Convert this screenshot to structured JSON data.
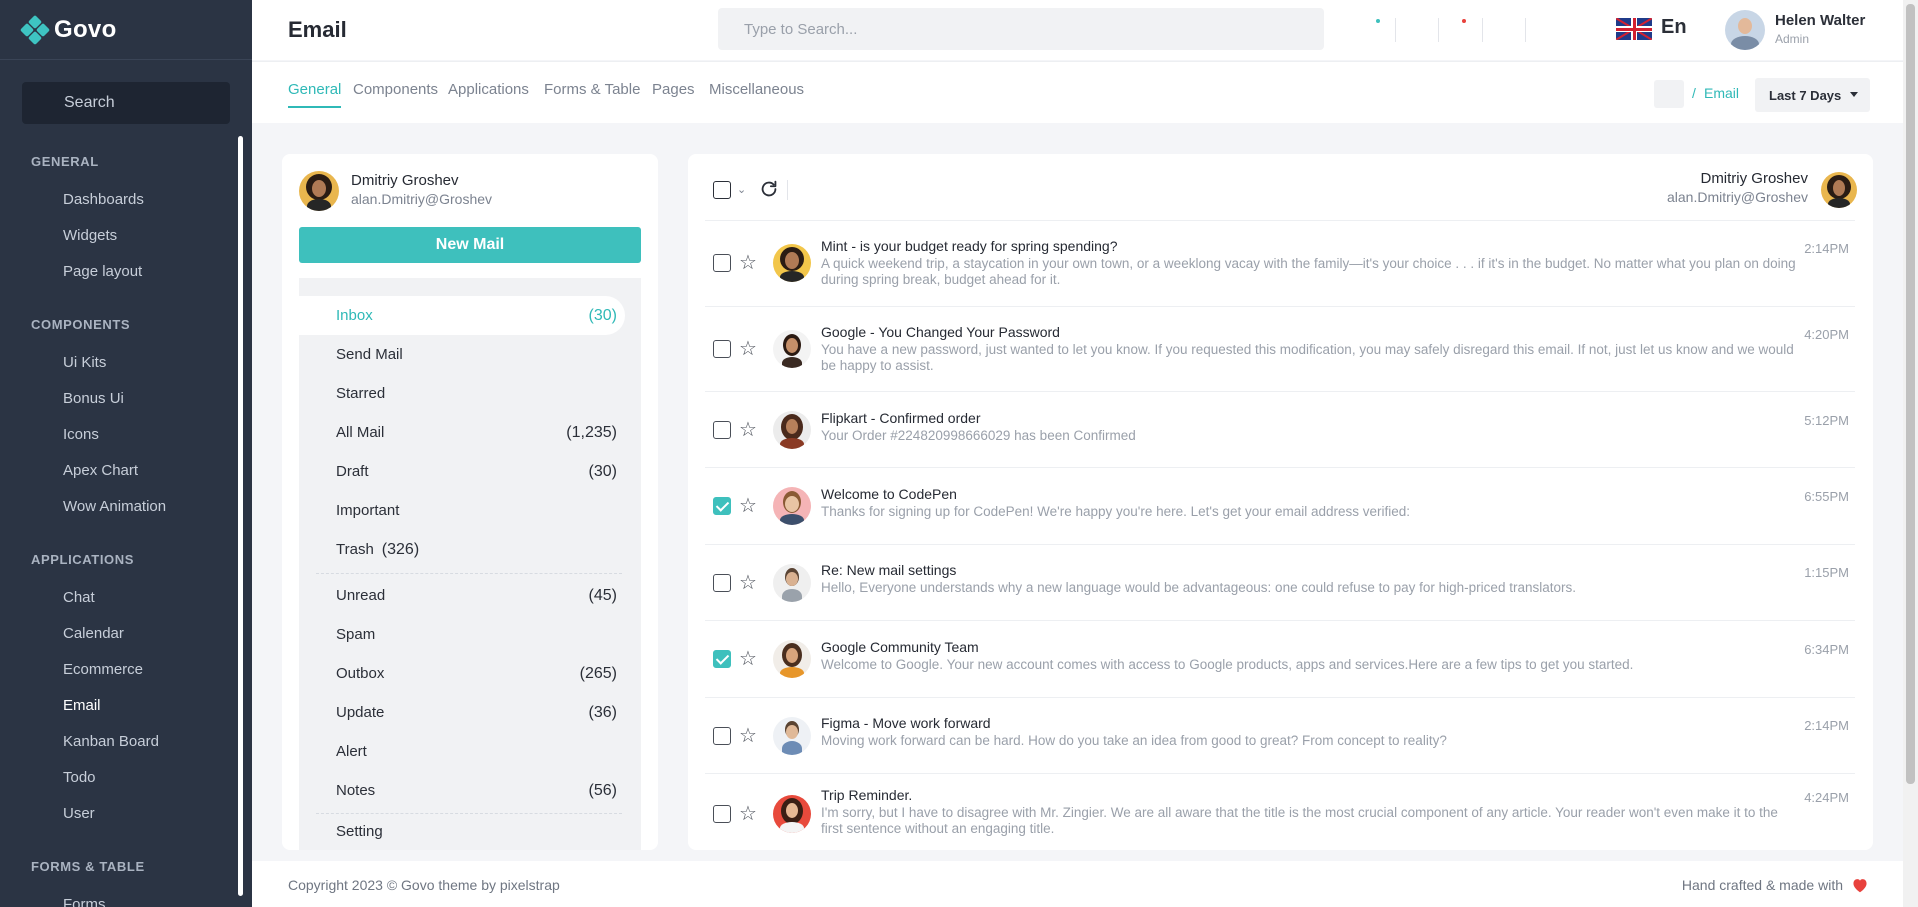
{
  "app": {
    "name": "Govo"
  },
  "sidebar": {
    "search_label": "Search",
    "sections": [
      {
        "title": "GENERAL",
        "items": [
          "Dashboards",
          "Widgets",
          "Page layout"
        ]
      },
      {
        "title": "COMPONENTS",
        "items": [
          "Ui Kits",
          "Bonus Ui",
          "Icons",
          "Apex Chart",
          "Wow Animation"
        ]
      },
      {
        "title": "APPLICATIONS",
        "items": [
          "Chat",
          "Calendar",
          "Ecommerce",
          "Email",
          "Kanban Board",
          "Todo",
          "User"
        ]
      },
      {
        "title": "FORMS & TABLE",
        "items": [
          "Forms"
        ]
      }
    ],
    "active_item": "Email"
  },
  "header": {
    "title": "Email",
    "search_placeholder": "Type to Search...",
    "language": "En",
    "user_name": "Helen Walter",
    "user_role": "Admin"
  },
  "subheader": {
    "tabs": [
      "General",
      "Components",
      "Applications",
      "Forms & Table",
      "Pages",
      "Miscellaneous"
    ],
    "active_tab": "General",
    "breadcrumb_sep": "/",
    "breadcrumb": "Email",
    "range_label": "Last 7 Days"
  },
  "profile": {
    "name": "Dmitriy Groshev",
    "email": "alan.Dmitriy@Groshev",
    "new_mail_label": "New Mail"
  },
  "folders": [
    {
      "label": "Inbox",
      "count": "(30)",
      "active": true
    },
    {
      "label": "Send Mail",
      "count": ""
    },
    {
      "label": "Starred",
      "count": ""
    },
    {
      "label": "All Mail",
      "count": "(1,235)"
    },
    {
      "label": "Draft",
      "count": "(30)"
    },
    {
      "label": "Important",
      "count": ""
    },
    {
      "label": "Trash",
      "inline_count": "(326)"
    },
    {
      "label": "Unread",
      "count": "(45)"
    },
    {
      "label": "Spam",
      "count": ""
    },
    {
      "label": "Outbox",
      "count": "(265)"
    },
    {
      "label": "Update",
      "count": "(36)"
    },
    {
      "label": "Alert",
      "count": ""
    },
    {
      "label": "Notes",
      "count": "(56)"
    },
    {
      "label": "Setting",
      "count": ""
    }
  ],
  "mail_header": {
    "name": "Dmitriy Groshev",
    "email": "alan.Dmitriy@Groshev"
  },
  "mails": [
    {
      "subject": "Mint - is your budget ready for spring spending?",
      "snippet": "A quick weekend trip, a staycation in your own town, or a weeklong vacay with the family—it's your choice . . . if it's in the budget. No matter what you plan on doing during spring break, budget ahead for it.",
      "time": "2:14PM",
      "checked": false
    },
    {
      "subject": "Google - You Changed Your Password",
      "snippet": "You have a new password, just wanted to let you know. If you requested this modification, you may safely disregard this email. If not, just let us know and we would be happy to assist.",
      "time": "4:20PM",
      "checked": false
    },
    {
      "subject": "Flipkart - Confirmed order",
      "snippet": "Your Order #224820998666029 has been Confirmed",
      "time": "5:12PM",
      "checked": false
    },
    {
      "subject": "Welcome to CodePen",
      "snippet": "Thanks for signing up for CodePen! We're happy you're here. Let's get your email address verified:",
      "time": "6:55PM",
      "checked": true
    },
    {
      "subject": "Re: New mail settings",
      "snippet": "Hello, Everyone understands why a new language would be advantageous: one could refuse to pay for high-priced translators.",
      "time": "1:15PM",
      "checked": false
    },
    {
      "subject": "Google Community Team",
      "snippet": "Welcome to Google. Your new account comes with access to Google products, apps and services.Here are a few tips to get you started.",
      "time": "6:34PM",
      "checked": true
    },
    {
      "subject": "Figma - Move work forward",
      "snippet": "Moving work forward can be hard. How do you take an idea from good to great? From concept to reality?",
      "time": "2:14PM",
      "checked": false
    },
    {
      "subject": "Trip Reminder.",
      "snippet": "I'm sorry, but I have to disagree with Mr. Zingier. We are all aware that the title is the most crucial component of any article. Your reader won't even make it to the first sentence without an engaging title.",
      "time": "4:24PM",
      "checked": false
    }
  ],
  "footer": {
    "copyright": "Copyright 2023 © Govo theme by pixelstrap",
    "made_with": "Hand crafted & made with"
  },
  "colors": {
    "accent": "#3ec0bd",
    "sidebar_bg": "#2b3444",
    "heart": "#e8413c"
  }
}
